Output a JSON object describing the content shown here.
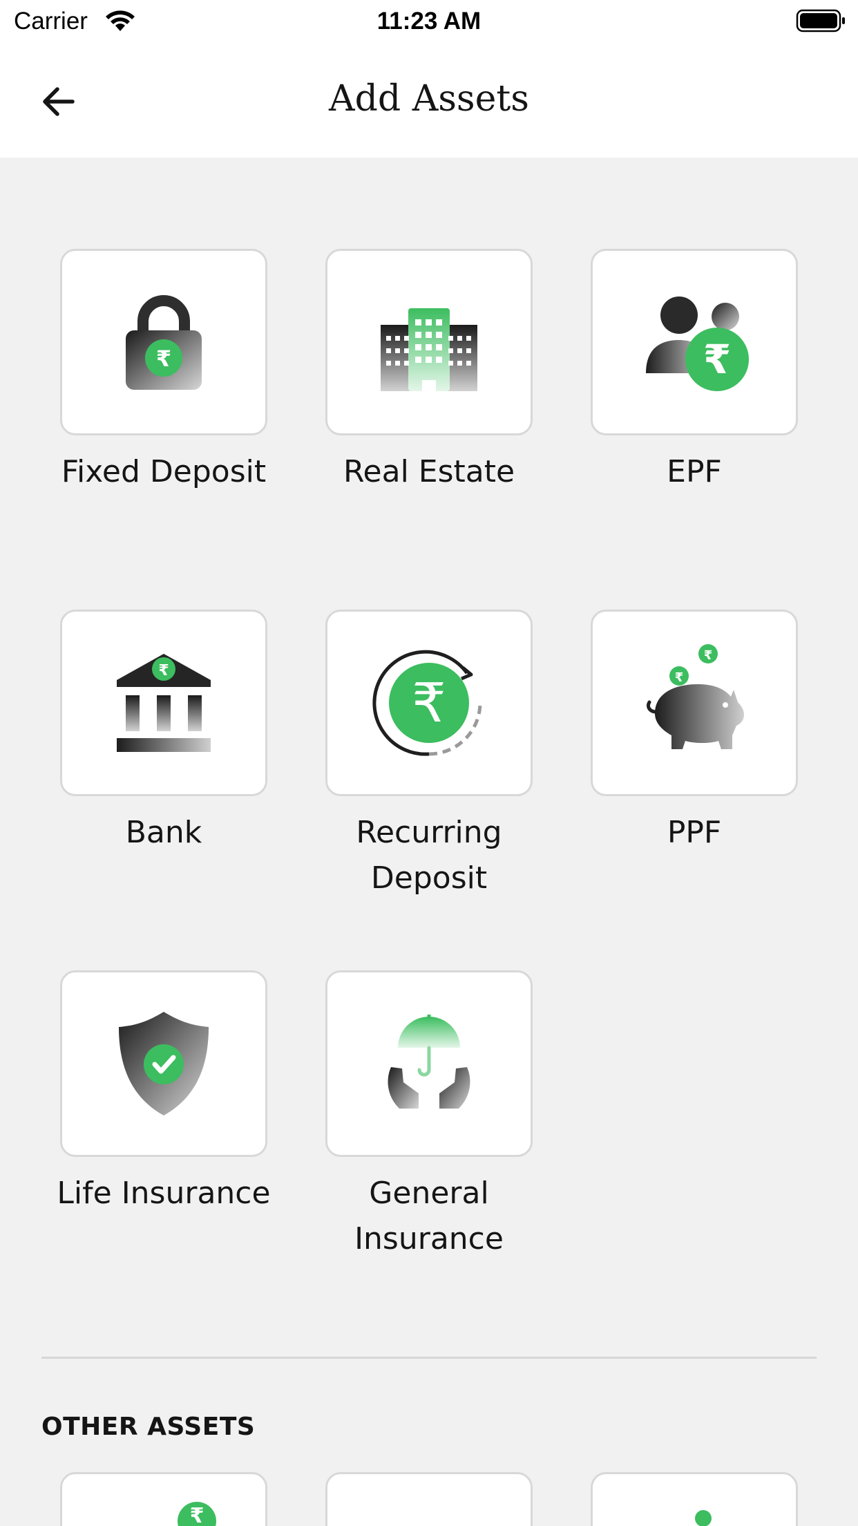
{
  "status_bar": {
    "carrier": "Carrier",
    "time": "11:23 AM"
  },
  "header": {
    "title": "Add Assets",
    "back_icon": "arrow-left-icon"
  },
  "colors": {
    "accent": "#3cbd5f",
    "background": "#f1f1f1",
    "card": "#ffffff",
    "card_border": "#d8d8d8"
  },
  "assets": [
    {
      "label": "Fixed Deposit",
      "icon": "padlock-rupee-icon"
    },
    {
      "label": "Real Estate",
      "icon": "buildings-icon"
    },
    {
      "label": "EPF",
      "icon": "people-rupee-icon"
    },
    {
      "label": "Bank",
      "icon": "bank-rupee-icon"
    },
    {
      "label": "Recurring\nDeposit",
      "icon": "rupee-cycle-icon"
    },
    {
      "label": "PPF",
      "icon": "piggy-bank-icon"
    },
    {
      "label": "Life Insurance",
      "icon": "shield-check-icon"
    },
    {
      "label": "General\nInsurance",
      "icon": "umbrella-hands-icon"
    }
  ],
  "other_assets": {
    "heading": "OTHER ASSETS"
  }
}
